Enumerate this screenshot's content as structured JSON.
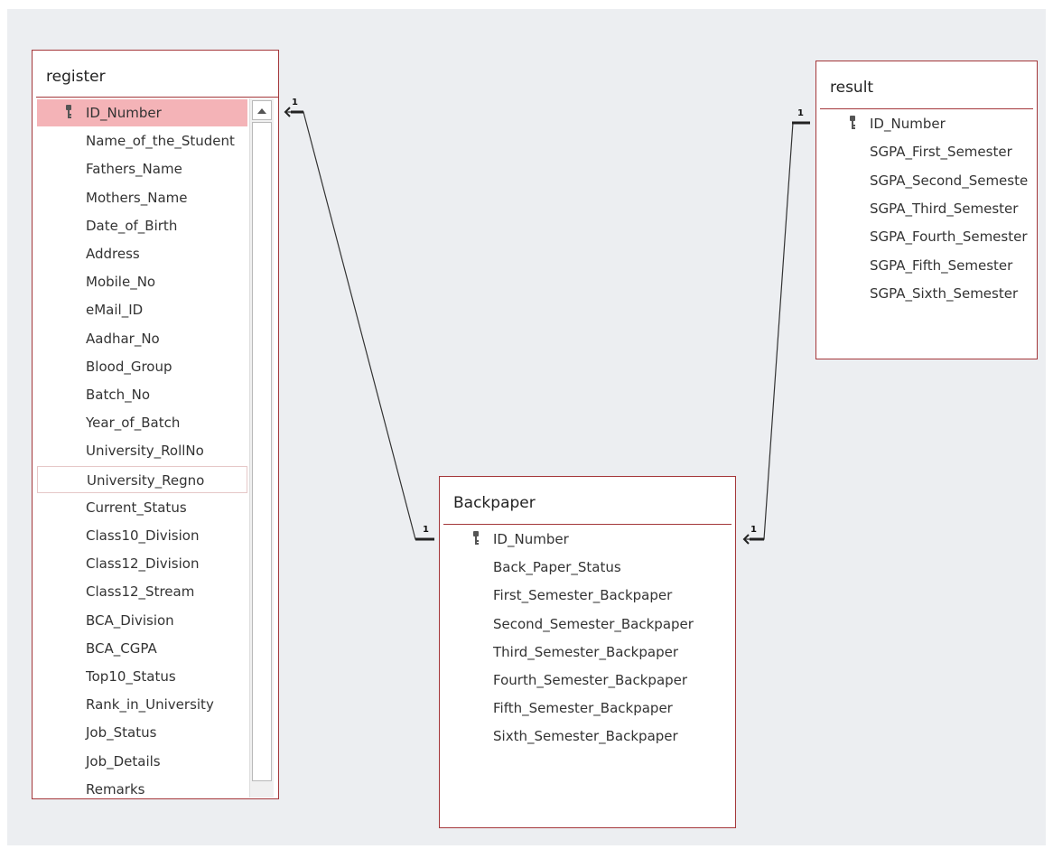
{
  "tables": {
    "register": {
      "title": "register",
      "fields": [
        "ID_Number",
        "Name_of_the_Student",
        "Fathers_Name",
        "Mothers_Name",
        "Date_of_Birth",
        "Address",
        "Mobile_No",
        "eMail_ID",
        "Aadhar_No",
        "Blood_Group",
        "Batch_No",
        "Year_of_Batch",
        "University_RollNo",
        "University_Regno",
        "Current_Status",
        "Class10_Division",
        "Class12_Division",
        "Class12_Stream",
        "BCA_Division",
        "BCA_CGPA",
        "Top10_Status",
        "Rank_in_University",
        "Job_Status",
        "Job_Details",
        "Remarks"
      ],
      "primary_key": "ID_Number",
      "selected_field": "ID_Number",
      "outlined_field": "University_Regno"
    },
    "result": {
      "title": "result",
      "fields": [
        "ID_Number",
        "SGPA_First_Semester",
        "SGPA_Second_Semeste",
        "SGPA_Third_Semester",
        "SGPA_Fourth_Semester",
        "SGPA_Fifth_Semester",
        "SGPA_Sixth_Semester"
      ],
      "primary_key": "ID_Number"
    },
    "backpaper": {
      "title": "Backpaper",
      "fields": [
        "ID_Number",
        "Back_Paper_Status",
        "First_Semester_Backpaper",
        "Second_Semester_Backpaper",
        "Third_Semester_Backpaper",
        "Fourth_Semester_Backpaper",
        "Fifth_Semester_Backpaper",
        "Sixth_Semester_Backpaper"
      ],
      "primary_key": "ID_Number"
    }
  },
  "relationships": [
    {
      "from": "Backpaper.ID_Number",
      "to": "register.ID_Number",
      "from_cardinality": "1",
      "to_cardinality": "1"
    },
    {
      "from": "result.ID_Number",
      "to": "Backpaper.ID_Number",
      "from_cardinality": "1",
      "to_cardinality": "1"
    }
  ],
  "colors": {
    "border": "#a4373a",
    "highlight": "#f4b3b7",
    "canvas": "#eceef1"
  },
  "icons": {
    "key": "key-icon",
    "scroll_up": "chevron-up-icon",
    "scroll_down": "chevron-down-icon"
  }
}
